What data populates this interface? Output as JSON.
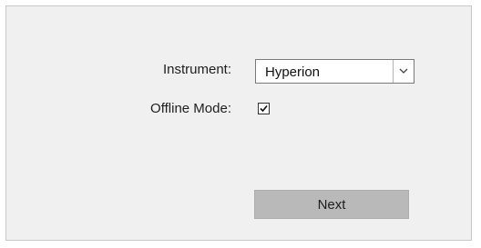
{
  "form": {
    "instrument_label": "Instrument:",
    "instrument_value": "Hyperion",
    "offline_label": "Offline Mode:",
    "offline_checked": true
  },
  "actions": {
    "next_label": "Next"
  },
  "icons": {
    "dropdown": "chevron-down-icon",
    "check": "checkmark-icon"
  }
}
